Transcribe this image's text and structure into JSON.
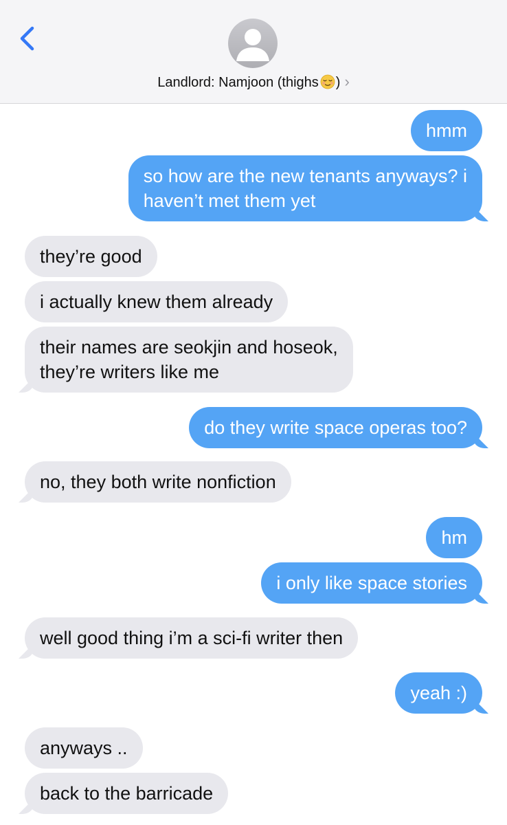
{
  "header": {
    "contact_name_prefix": "Landlord: Namjoon (thighs",
    "contact_name_suffix": ")",
    "chevron": "›",
    "back_icon": "chevron-left-icon",
    "emoji": "relieved-face-emoji"
  },
  "colors": {
    "sent_bubble": "#54a4f5",
    "received_bubble": "#e8e8ed",
    "accent": "#3478f6"
  },
  "messages": [
    {
      "from": "me",
      "lines": [
        "hmm"
      ]
    },
    {
      "from": "me",
      "lines": [
        "so how are the new tenants anyways? i",
        "haven’t met them yet"
      ]
    },
    {
      "from": "them",
      "lines": [
        "they’re good"
      ]
    },
    {
      "from": "them",
      "lines": [
        "i actually knew them already"
      ]
    },
    {
      "from": "them",
      "lines": [
        "their names are seokjin and hoseok,",
        "they’re writers like me"
      ]
    },
    {
      "from": "me",
      "lines": [
        "do they write space operas too?"
      ]
    },
    {
      "from": "them",
      "lines": [
        "no, they both write nonfiction"
      ]
    },
    {
      "from": "me",
      "lines": [
        "hm"
      ]
    },
    {
      "from": "me",
      "lines": [
        "i only like space stories"
      ]
    },
    {
      "from": "them",
      "lines": [
        "well good thing i’m a sci-fi writer then"
      ]
    },
    {
      "from": "me",
      "lines": [
        "yeah :)"
      ]
    },
    {
      "from": "them",
      "lines": [
        "anyways .."
      ]
    },
    {
      "from": "them",
      "lines": [
        "back to the barricade"
      ]
    }
  ]
}
